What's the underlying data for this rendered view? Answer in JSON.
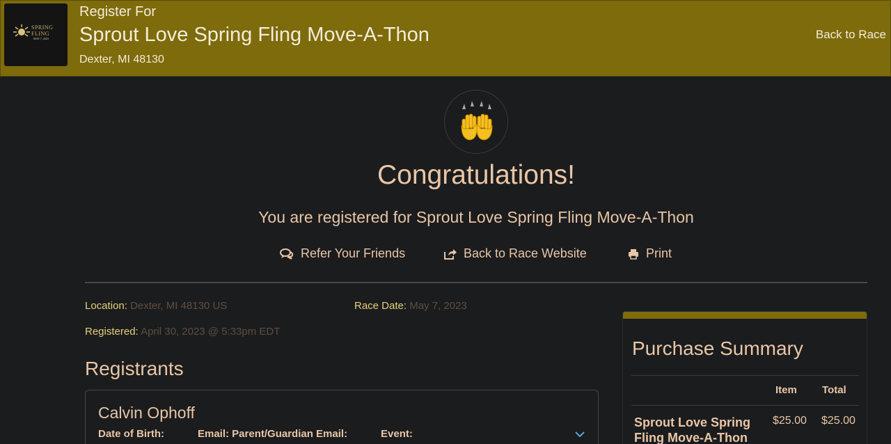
{
  "header": {
    "subtitle": "Register For",
    "title": "Sprout Love Spring Fling Move-A-Thon",
    "location": "Dexter, MI 48130",
    "back_link": "Back to Race",
    "logo": {
      "line1": "SPRING",
      "line2": "FLING",
      "date": "MAY 7, 2023"
    },
    "bg_color": "#7d6b0c"
  },
  "hero": {
    "icon": "raising-hands-icon",
    "heading": "Congratulations!",
    "message": "You are registered for Sprout Love Spring Fling Move-A-Thon"
  },
  "actions": [
    {
      "label": "Refer Your Friends",
      "icon": "chat-bubbles-icon"
    },
    {
      "label": "Back to Race Website",
      "icon": "share-icon"
    },
    {
      "label": "Print",
      "icon": "printer-icon"
    }
  ],
  "details": {
    "location_label": "Location:",
    "location_value": "Dexter, MI 48130 US",
    "race_date_label": "Race Date:",
    "race_date_value": "May 7, 2023",
    "registered_label": "Registered:",
    "registered_value": "April 30, 2023 @ 5:33pm EDT"
  },
  "registrants": {
    "heading": "Registrants",
    "items": [
      {
        "name": "Calvin Ophoff",
        "dob_label": "Date of Birth:",
        "email_label": "Email: Parent/Guardian Email:",
        "event_label": "Event:"
      }
    ]
  },
  "purchase_summary": {
    "title": "Purchase Summary",
    "col_item": "Item",
    "col_total": "Total",
    "rows": [
      {
        "name": "Sprout Love Spring Fling Move-A-Thon",
        "item": "$25.00",
        "total": "$25.00"
      }
    ]
  },
  "colors": {
    "accent": "#7d6b0c",
    "text": "#e9c6a6",
    "label": "#e6d07a",
    "value": "#5f4e3f",
    "background": "#1b1c1e"
  }
}
